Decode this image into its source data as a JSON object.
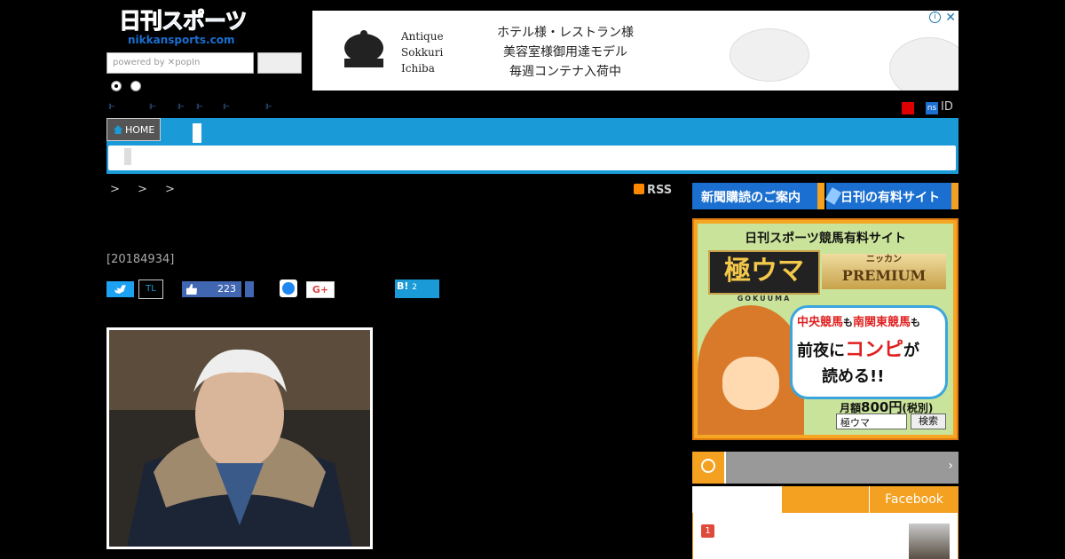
{
  "header": {
    "logo_jp": "日刊スポーツ",
    "logo_en": "nikkansports.com",
    "search_placeholder": "powered by ✕popIn"
  },
  "ad": {
    "brand_lines": [
      "Antique",
      "Sokkuri",
      "Ichiba"
    ],
    "text_lines": [
      "ホテル様・レストラン様",
      "美容室様御用達モデル",
      "毎週コンテナ入荷中"
    ]
  },
  "nav": {
    "home_label": "HOME",
    "ns_label": "ns",
    "id_label": "ID"
  },
  "breadcrumb": {
    "separators": "> > >",
    "rss_label": "RSS"
  },
  "article": {
    "date_text": "[20184934]"
  },
  "share": {
    "tl_label": "TL",
    "fb_count": "223",
    "gplus_label": "G+",
    "hatena_label": "B!",
    "hatena_count": "2"
  },
  "sidebar": {
    "subscribe_label": "新聞購読のご案内",
    "paid_site_label": "日刊の有料サイト",
    "banner": {
      "title": "日刊スポーツ競馬有料サイト",
      "logo": "極ウマ",
      "logo_sub": "GOKUUMA",
      "premium_small": "ニッカン",
      "premium_big": "PREMIUM",
      "line1a": "中央競馬",
      "line1b": "も",
      "line1c": "南関東競馬",
      "line1d": "も",
      "line2a": "前夜に",
      "line2b": "コンピ",
      "line2c": "が",
      "line3": "読める!!",
      "price_a": "月額",
      "price_b": "800円",
      "price_c": "(税別)",
      "search_value": "極ウマ",
      "search_button": "検索"
    },
    "ranking": {
      "tab_facebook": "Facebook",
      "first_rank": "1"
    }
  },
  "colors": {
    "accent": "#1a9ad6",
    "brand": "#1a6fd0",
    "orange": "#f4a020"
  }
}
